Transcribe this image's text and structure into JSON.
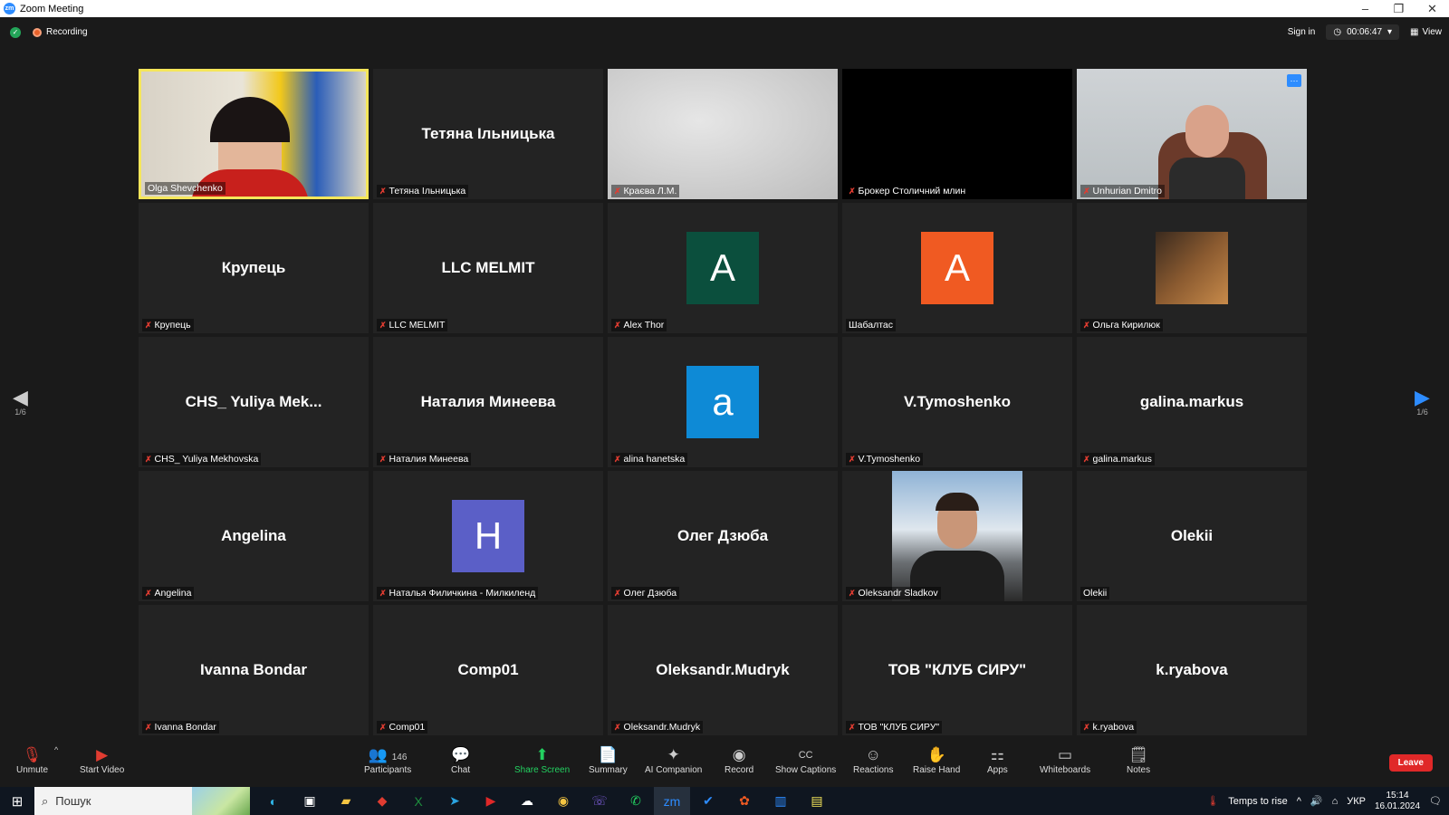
{
  "window": {
    "title": "Zoom Meeting"
  },
  "topbar": {
    "recording_label": "Recording",
    "signin_label": "Sign in",
    "timer": "00:06:47",
    "view_label": "View"
  },
  "tiles": [
    {
      "name": "Olga Shevchenko",
      "display": "",
      "kind": "video",
      "muted": false,
      "active": true,
      "scene": "olga"
    },
    {
      "name": "Тетяна Ільницька",
      "display": "Тетяна Ільницька",
      "kind": "name",
      "muted": true
    },
    {
      "name": "Краєва Л.М.",
      "display": "",
      "kind": "video",
      "muted": true,
      "scene": "wall"
    },
    {
      "name": "Брокер Столичний млин",
      "display": "",
      "kind": "video",
      "muted": true,
      "scene": "black"
    },
    {
      "name": "Unhurian Dmitro",
      "display": "",
      "kind": "video",
      "muted": true,
      "scene": "man",
      "more": true
    },
    {
      "name": "Крупець",
      "display": "Крупець",
      "kind": "name",
      "muted": true
    },
    {
      "name": "LLC MELMIT",
      "display": "LLC MELMIT",
      "kind": "name",
      "muted": true
    },
    {
      "name": "Alex Thor",
      "display": "",
      "kind": "avatar",
      "letter": "A",
      "color": "#0b4f3d",
      "muted": true
    },
    {
      "name": "Шабалтас",
      "display": "",
      "kind": "avatar",
      "letter": "A",
      "color": "#f05a22",
      "muted": false
    },
    {
      "name": "Ольга Кирилюк",
      "display": "",
      "kind": "picture",
      "muted": true
    },
    {
      "name": "CHS_ Yuliya Mekhovska",
      "display": "CHS_ Yuliya Mek...",
      "kind": "name",
      "muted": true
    },
    {
      "name": "Наталия Минеева",
      "display": "Наталия Минеева",
      "kind": "name",
      "muted": true
    },
    {
      "name": "alina hanetska",
      "display": "",
      "kind": "avatar",
      "letter": "a",
      "color": "#0e8ad6",
      "muted": true
    },
    {
      "name": "V.Tymoshenko",
      "display": "V.Tymoshenko",
      "kind": "name",
      "muted": true
    },
    {
      "name": "galina.markus",
      "display": "galina.markus",
      "kind": "name",
      "muted": true
    },
    {
      "name": "Angelina",
      "display": "Angelina",
      "kind": "name",
      "muted": true
    },
    {
      "name": "Наталья Филичкина - Милкиленд",
      "display": "",
      "kind": "avatar",
      "letter": "H",
      "color": "#5b5fc7",
      "muted": true
    },
    {
      "name": "Олег Дзюба",
      "display": "Олег Дзюба",
      "kind": "name",
      "muted": true
    },
    {
      "name": "Oleksandr Sladkov",
      "display": "",
      "kind": "photo",
      "muted": true
    },
    {
      "name": "Olekii",
      "display": "Olekii",
      "kind": "name",
      "muted": false
    },
    {
      "name": "Ivanna Bondar",
      "display": "Ivanna Bondar",
      "kind": "name",
      "muted": true
    },
    {
      "name": "Comp01",
      "display": "Comp01",
      "kind": "name",
      "muted": true
    },
    {
      "name": "Oleksandr.Mudryk",
      "display": "Oleksandr.Mudryk",
      "kind": "name",
      "muted": true
    },
    {
      "name": "ТОВ \"КЛУБ СИРУ\"",
      "display": "ТОВ \"КЛУБ СИРУ\"",
      "kind": "name",
      "muted": true
    },
    {
      "name": "k.ryabova",
      "display": "k.ryabova",
      "kind": "name",
      "muted": true
    }
  ],
  "pager": {
    "left": "1/6",
    "right": "1/6"
  },
  "toolbar": {
    "unmute": "Unmute",
    "start_video": "Start Video",
    "participants": "Participants",
    "participants_count": "146",
    "chat": "Chat",
    "share_screen": "Share Screen",
    "summary": "Summary",
    "ai_companion": "AI Companion",
    "record": "Record",
    "show_captions": "Show Captions",
    "reactions": "Reactions",
    "raise_hand": "Raise Hand",
    "apps": "Apps",
    "whiteboards": "Whiteboards",
    "notes": "Notes",
    "leave": "Leave"
  },
  "taskbar": {
    "search_placeholder": "Пошук",
    "weather": "Temps to rise",
    "lang": "УКР",
    "time": "15:14",
    "date": "16.01.2024"
  }
}
